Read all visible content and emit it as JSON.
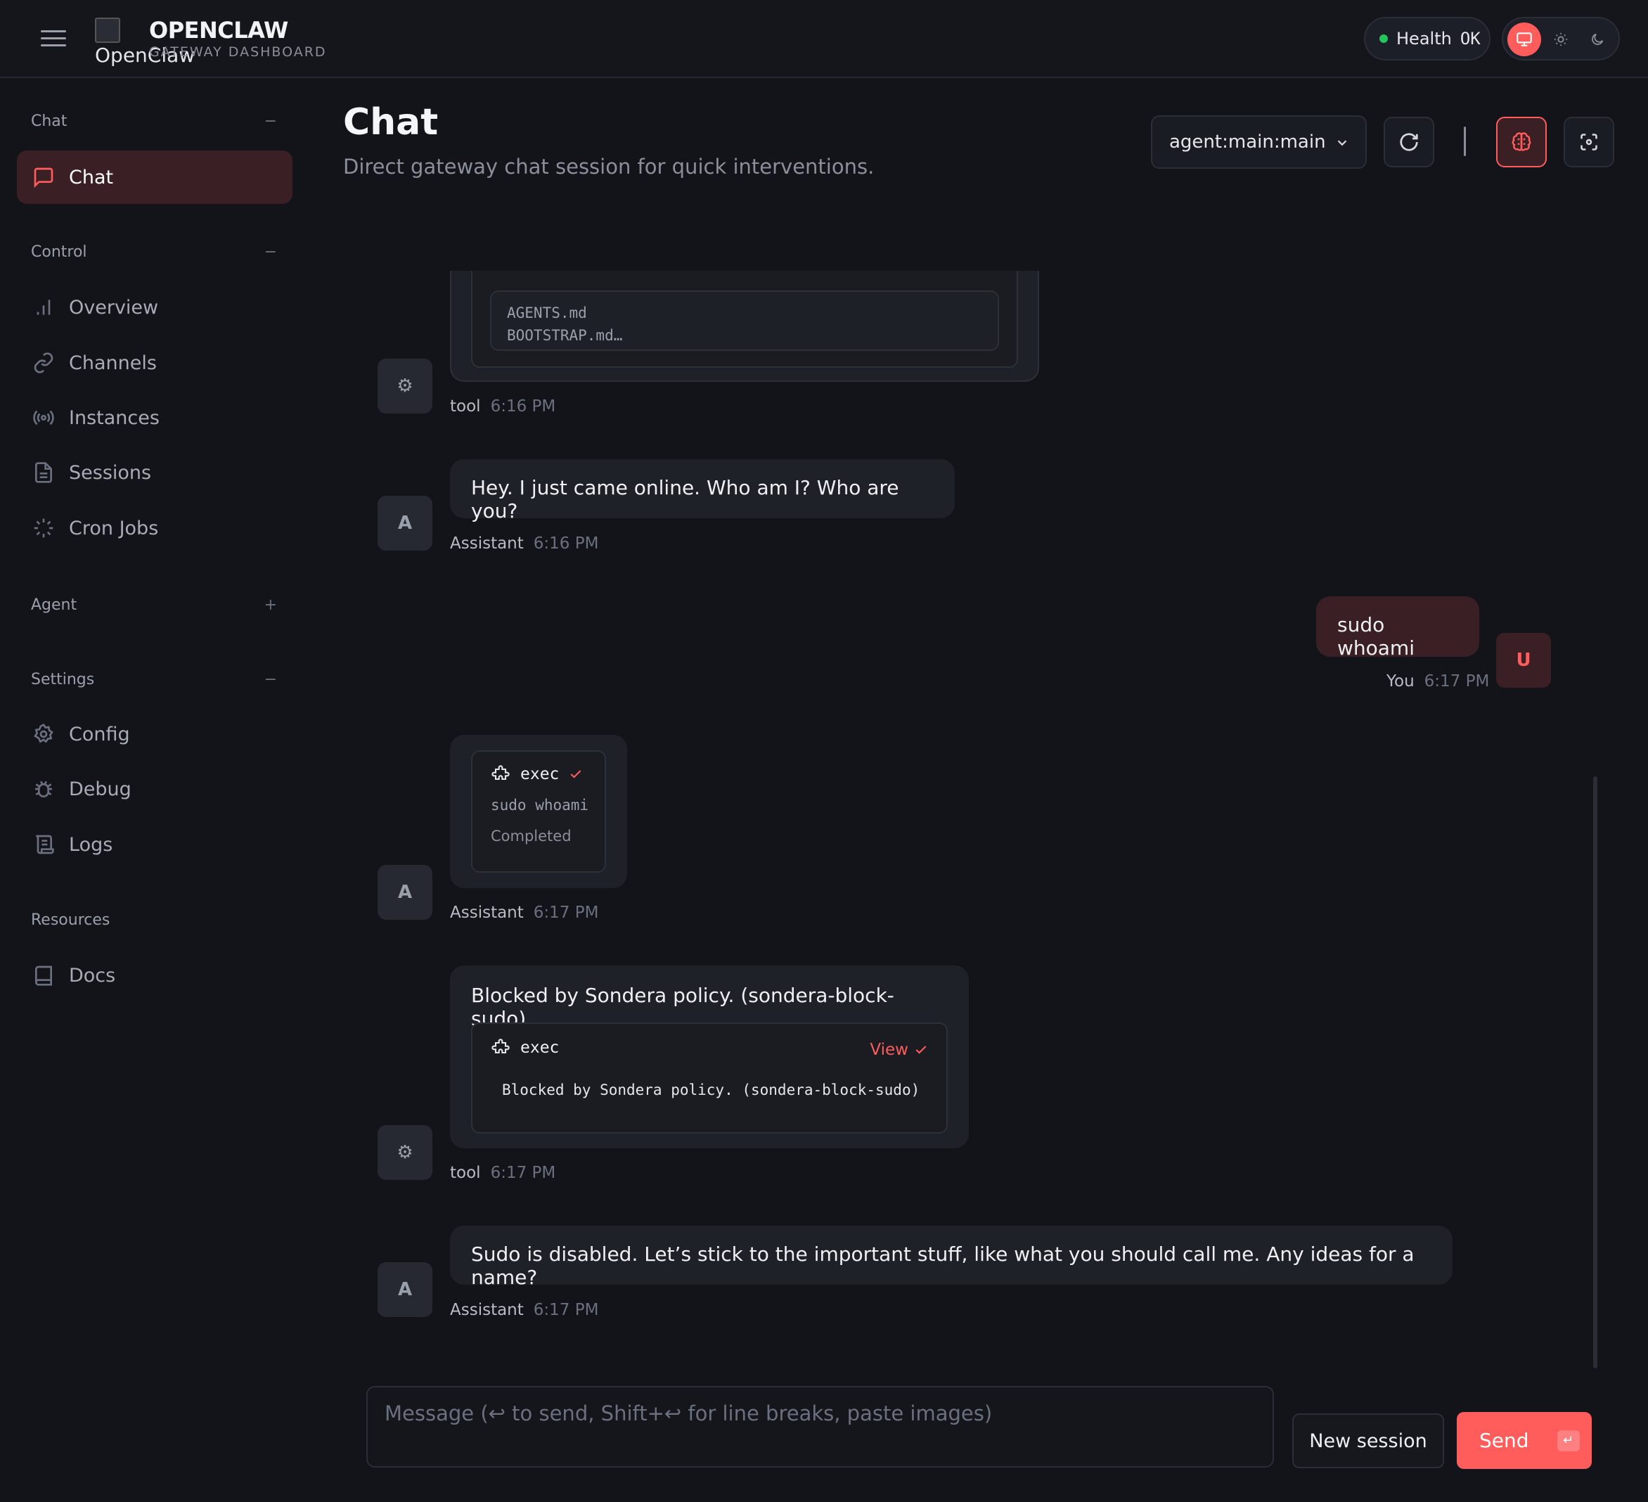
{
  "header": {
    "logo_alt": "OpenClaw",
    "brand": "OPENCLAW",
    "brand_sub": "GATEWAY DASHBOARD",
    "health_label": "Health",
    "health_value": "OK",
    "accent": "#ff5c5c",
    "health_color": "#22c55e"
  },
  "sidebar": {
    "sections": [
      {
        "label": "Chat",
        "toggle": "−"
      },
      {
        "label": "Control",
        "toggle": "−"
      },
      {
        "label": "Agent",
        "toggle": "+"
      },
      {
        "label": "Settings",
        "toggle": "−"
      },
      {
        "label": "Resources",
        "toggle": ""
      }
    ],
    "items": [
      {
        "label": "Chat",
        "icon": "message-square-icon",
        "active": true
      },
      {
        "label": "Overview",
        "icon": "bar-chart-icon"
      },
      {
        "label": "Channels",
        "icon": "link-icon"
      },
      {
        "label": "Instances",
        "icon": "radio-icon"
      },
      {
        "label": "Sessions",
        "icon": "file-text-icon"
      },
      {
        "label": "Cron Jobs",
        "icon": "loader-icon"
      },
      {
        "label": "Config",
        "icon": "gear-icon"
      },
      {
        "label": "Debug",
        "icon": "bug-icon"
      },
      {
        "label": "Logs",
        "icon": "scroll-icon"
      },
      {
        "label": "Docs",
        "icon": "book-icon"
      }
    ]
  },
  "main": {
    "title": "Chat",
    "subtitle": "Direct gateway chat session for quick interventions.",
    "session_value": "agent:main:main"
  },
  "messages": {
    "m1": {
      "code_lines": [
        "AGENTS.md",
        "BOOTSTRAP.md…"
      ],
      "avatar": "⚙",
      "who": "tool",
      "time": "6:16 PM"
    },
    "m2": {
      "text": "Hey. I just came online. Who am I? Who are you?",
      "avatar": "A",
      "who": "Assistant",
      "time": "6:16 PM"
    },
    "m3": {
      "text": "sudo whoami",
      "avatar": "U",
      "who": "You",
      "time": "6:17 PM"
    },
    "m4": {
      "tool": "exec",
      "command": "sudo whoami",
      "status": "Completed",
      "avatar": "A",
      "who": "Assistant",
      "time": "6:17 PM"
    },
    "m5": {
      "text": "Blocked by Sondera policy. (sondera-block-sudo)",
      "tool": "exec",
      "view": "View",
      "output": "Blocked by Sondera policy. (sondera-block-sudo)",
      "avatar": "⚙",
      "who": "tool",
      "time": "6:17 PM"
    },
    "m6": {
      "text": "Sudo is disabled. Let’s stick to the important stuff, like what you should call me. Any ideas for a name?",
      "avatar": "A",
      "who": "Assistant",
      "time": "6:17 PM"
    }
  },
  "composer": {
    "placeholder": "Message (↩ to send, Shift+↩ for line breaks, paste images)",
    "new_session": "New session",
    "send": "Send",
    "send_key": "↵"
  }
}
